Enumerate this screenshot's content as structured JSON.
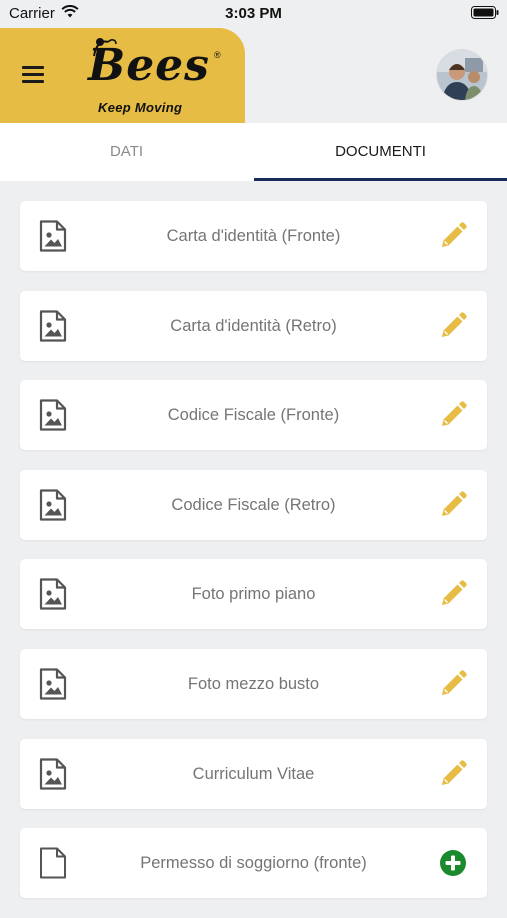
{
  "status_bar": {
    "carrier": "Carrier",
    "time": "3:03 PM"
  },
  "header": {
    "logo_text": "Bees",
    "logo_tagline": "Keep Moving",
    "brand_color": "#e6bc45"
  },
  "tabs": [
    {
      "label": "DATI",
      "active": false
    },
    {
      "label": "DOCUMENTI",
      "active": true
    }
  ],
  "accent_colors": {
    "tab_indicator": "#1c2c58",
    "edit_icon": "#e6bc45",
    "add_icon": "#1b8a2f"
  },
  "documents": [
    {
      "label": "Carta d'identità (Fronte)",
      "icon": "image-file-icon",
      "action": "pencil-icon"
    },
    {
      "label": "Carta d'identità (Retro)",
      "icon": "image-file-icon",
      "action": "pencil-icon"
    },
    {
      "label": "Codice Fiscale (Fronte)",
      "icon": "image-file-icon",
      "action": "pencil-icon"
    },
    {
      "label": "Codice Fiscale (Retro)",
      "icon": "image-file-icon",
      "action": "pencil-icon"
    },
    {
      "label": "Foto primo piano",
      "icon": "image-file-icon",
      "action": "pencil-icon"
    },
    {
      "label": "Foto mezzo busto",
      "icon": "image-file-icon",
      "action": "pencil-icon"
    },
    {
      "label": "Curriculum Vitae",
      "icon": "image-file-icon",
      "action": "pencil-icon"
    },
    {
      "label": "Permesso di soggiorno (fronte)",
      "icon": "blank-file-icon",
      "action": "add-circle-icon"
    }
  ]
}
